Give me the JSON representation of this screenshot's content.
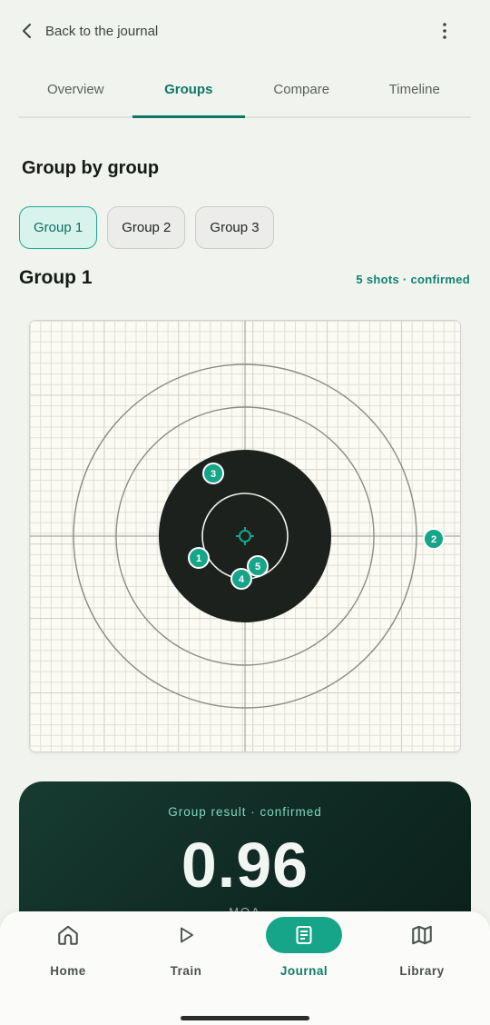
{
  "header": {
    "back_label": "Back to the journal",
    "back_icon": "chevron-left-icon",
    "more_icon": "more-vertical-icon"
  },
  "tabs": [
    {
      "label": "Overview",
      "active": false
    },
    {
      "label": "Groups",
      "active": true
    },
    {
      "label": "Compare",
      "active": false
    },
    {
      "label": "Timeline",
      "active": false
    }
  ],
  "section_title": "Group by group",
  "group_chips": [
    {
      "label": "Group 1",
      "active": true
    },
    {
      "label": "Group 2",
      "active": false
    },
    {
      "label": "Group 3",
      "active": false
    }
  ],
  "group": {
    "title": "Group 1",
    "meta": "5 shots · confirmed"
  },
  "target": {
    "shots": [
      {
        "label": "1"
      },
      {
        "label": "2"
      },
      {
        "label": "3"
      },
      {
        "label": "4"
      },
      {
        "label": "5"
      }
    ],
    "colors": {
      "paper": "#fbfaf3",
      "bull": "#1c211e",
      "shot": "#17a589",
      "center_mark": "#17a589"
    }
  },
  "result": {
    "kicker": "Group result · confirmed",
    "value": "0.96",
    "unit": "MOA"
  },
  "bottom_nav": [
    {
      "label": "Home",
      "icon": "home-icon",
      "active": false
    },
    {
      "label": "Train",
      "icon": "play-icon",
      "active": false
    },
    {
      "label": "Journal",
      "icon": "journal-icon",
      "active": true
    },
    {
      "label": "Library",
      "icon": "map-icon",
      "active": false
    }
  ],
  "colors": {
    "accent": "#17a589",
    "accent_dark": "#0e7866",
    "card_bg": "#173b31"
  }
}
